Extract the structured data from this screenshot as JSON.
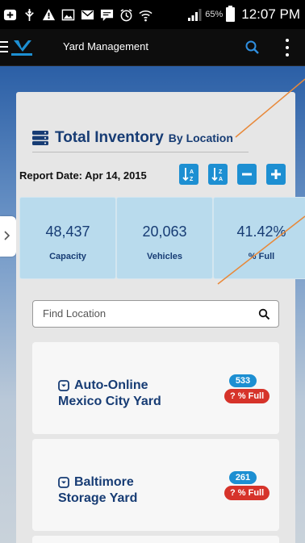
{
  "status_bar": {
    "battery": "65%",
    "time": "12:07 PM",
    "icons": [
      "add-icon",
      "usb-icon",
      "warning-icon",
      "image-icon",
      "mail-icon",
      "sms-icon",
      "alarm-icon",
      "wifi-icon",
      "signal-icon",
      "battery-icon"
    ]
  },
  "app_bar": {
    "title": "Yard Management",
    "icons": [
      "menu-icon",
      "brand-logo",
      "search-icon",
      "more-icon"
    ]
  },
  "report": {
    "title": "Total Inventory",
    "subtitle": "By Location",
    "date_label": "Report Date:",
    "date_value": "Apr 14, 2015",
    "toolbar_icons": [
      "sort-ascending-icon",
      "sort-descending-icon",
      "collapse-icon",
      "expand-icon"
    ]
  },
  "stats": [
    {
      "value": "48,437",
      "label": "Capacity"
    },
    {
      "value": "20,063",
      "label": "Vehicles"
    },
    {
      "value": "41.42%",
      "label": "% Full"
    }
  ],
  "search": {
    "placeholder": "Find Location"
  },
  "locations": [
    {
      "line1": "Auto-Online",
      "line2": "Mexico City Yard",
      "count": "533",
      "full": "? % Full"
    },
    {
      "line1": "Baltimore",
      "line2": "Storage Yard",
      "count": "261",
      "full": "? % Full"
    }
  ],
  "colors": {
    "primary_text": "#173c74",
    "accent_blue": "#1d8fd2",
    "badge_red": "#d6332a",
    "stat_bg": "#b9dbed",
    "annotation": "#e8893a"
  }
}
